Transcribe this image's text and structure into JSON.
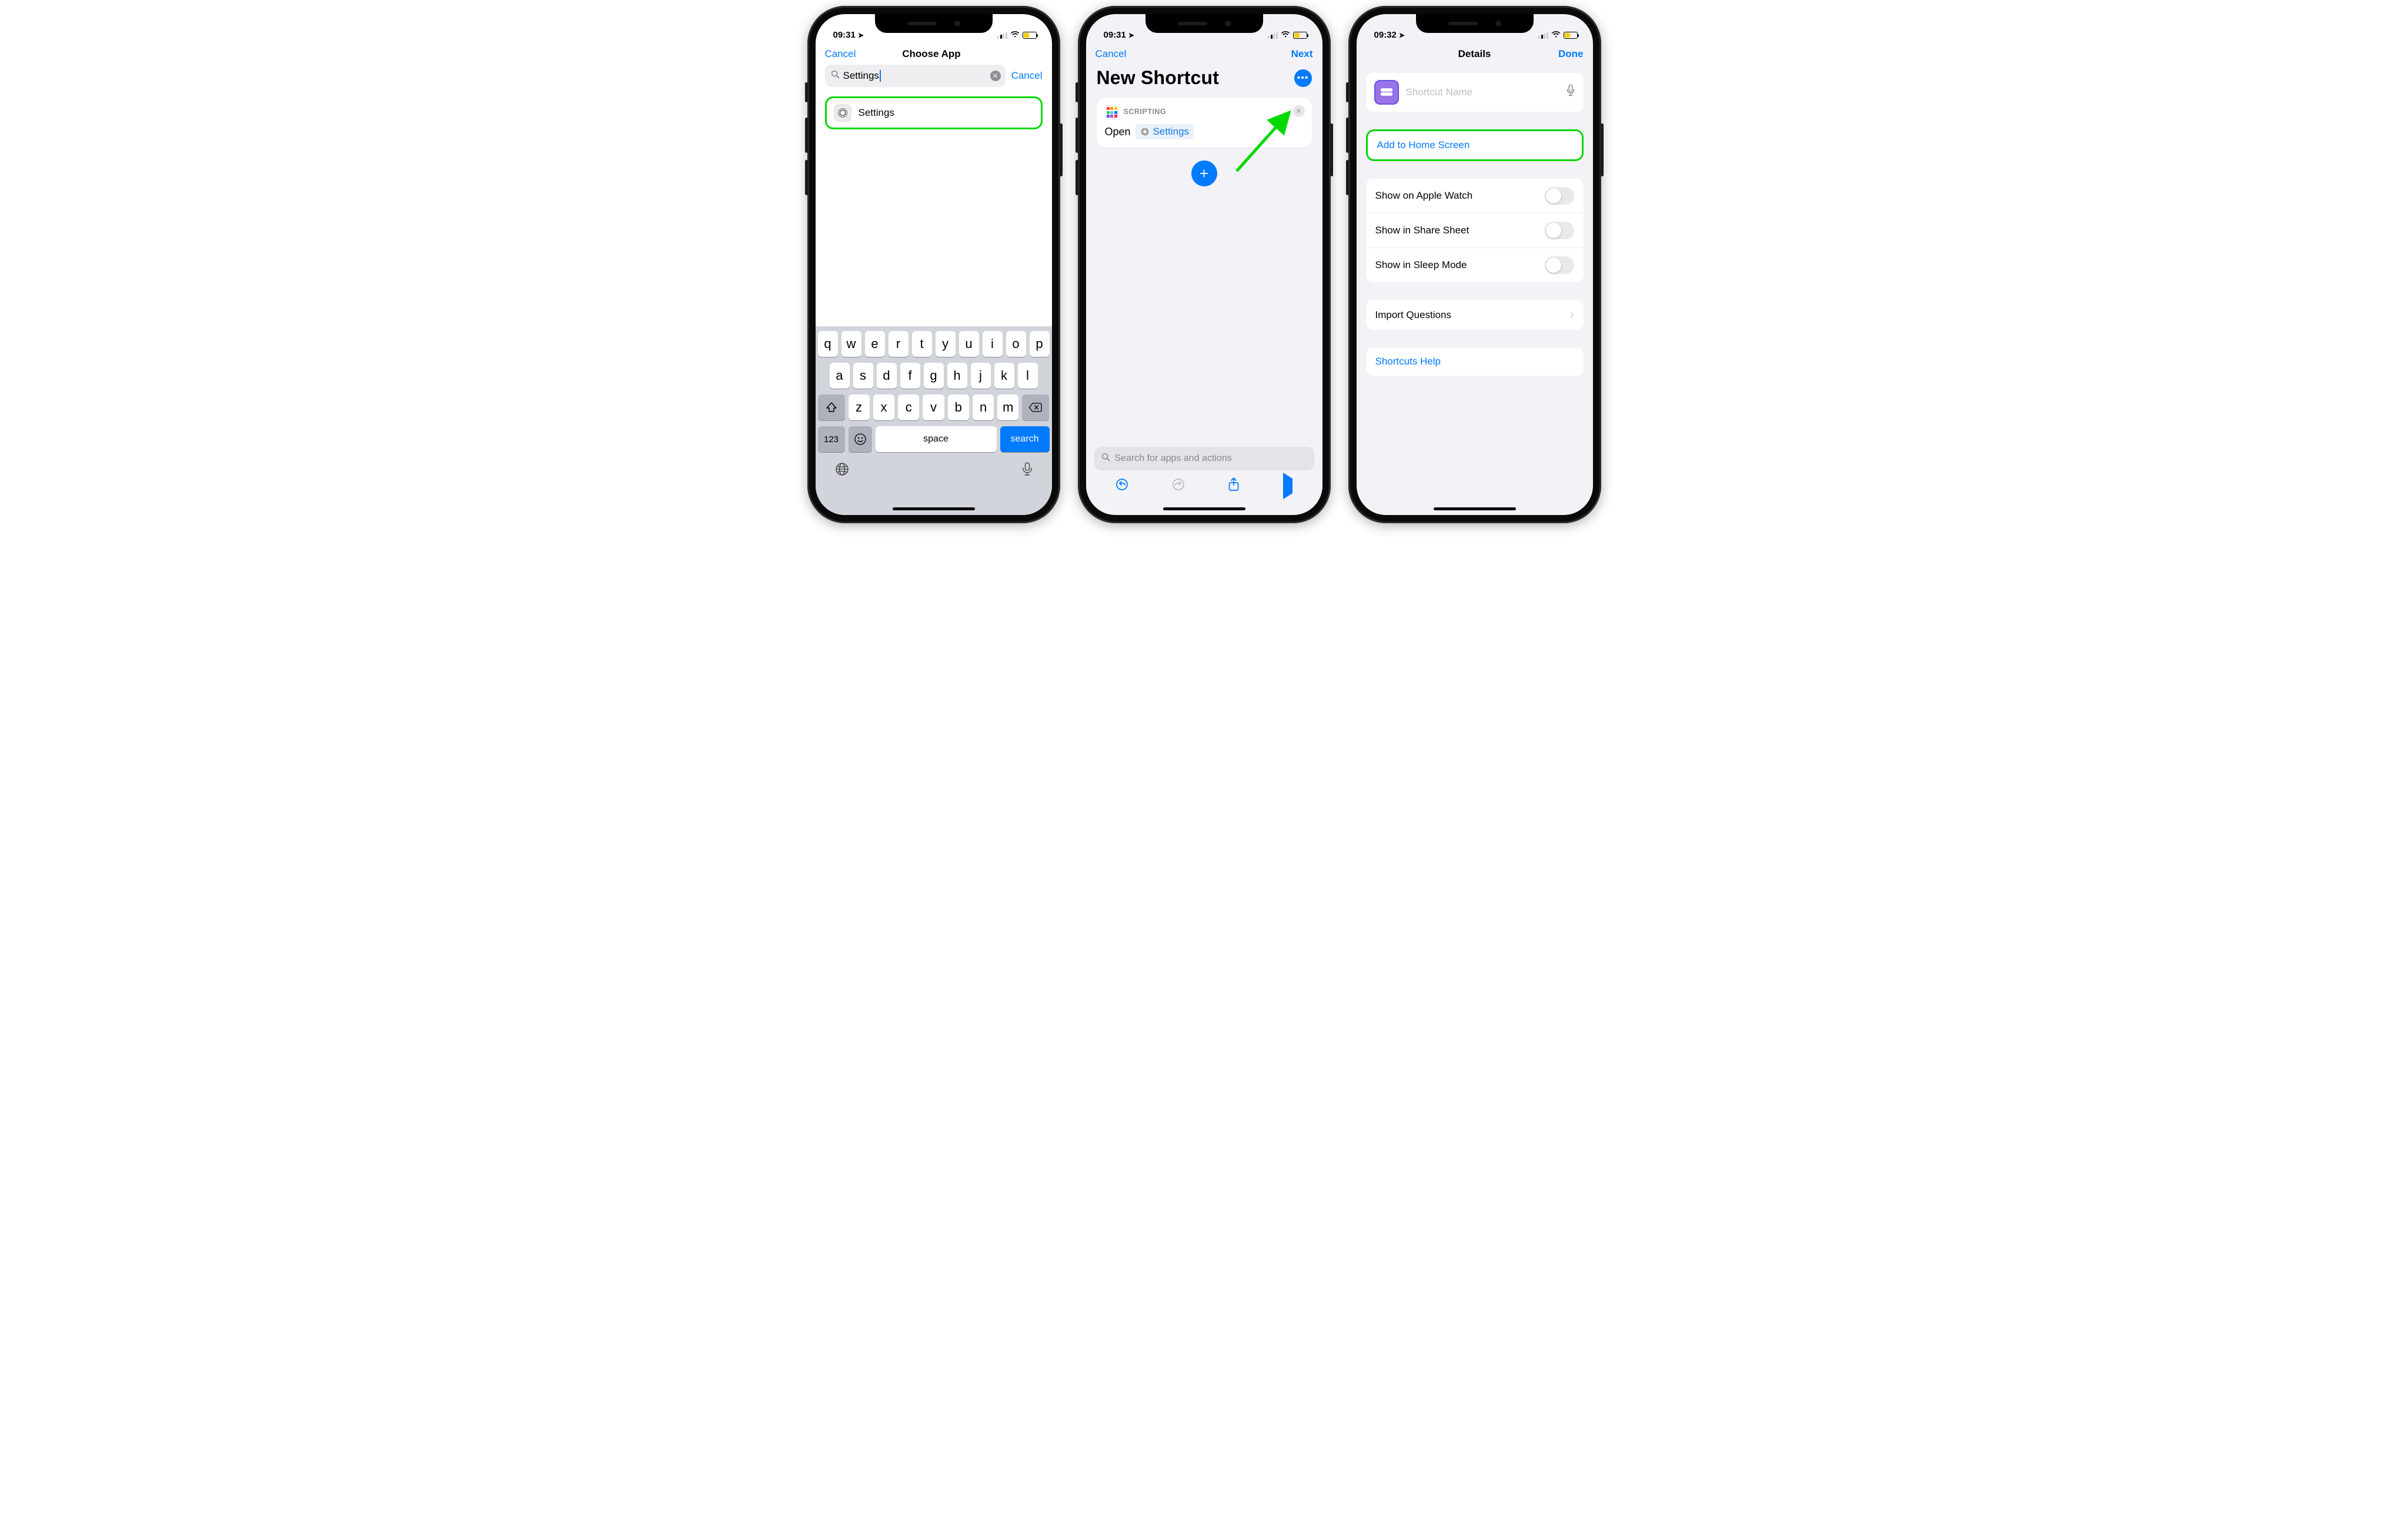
{
  "status": {
    "time1": "09:31",
    "time2": "09:31",
    "time3": "09:32"
  },
  "screen1": {
    "nav_cancel": "Cancel",
    "nav_title": "Choose App",
    "search_value": "Settings",
    "search_cancel": "Cancel",
    "result_label": "Settings",
    "keyboard": {
      "row1": [
        "q",
        "w",
        "e",
        "r",
        "t",
        "y",
        "u",
        "i",
        "o",
        "p"
      ],
      "row2": [
        "a",
        "s",
        "d",
        "f",
        "g",
        "h",
        "j",
        "k",
        "l"
      ],
      "row3": [
        "z",
        "x",
        "c",
        "v",
        "b",
        "n",
        "m"
      ],
      "nums": "123",
      "space": "space",
      "search": "search"
    }
  },
  "screen2": {
    "nav_cancel": "Cancel",
    "nav_next": "Next",
    "title": "New Shortcut",
    "action_category": "SCRIPTING",
    "action_verb": "Open",
    "action_param": "Settings",
    "bottom_search_placeholder": "Search for apps and actions"
  },
  "screen3": {
    "nav_title": "Details",
    "nav_done": "Done",
    "name_placeholder": "Shortcut Name",
    "add_home": "Add to Home Screen",
    "watch": "Show on Apple Watch",
    "share": "Show in Share Sheet",
    "sleep": "Show in Sleep Mode",
    "import_q": "Import Questions",
    "help": "Shortcuts Help"
  }
}
